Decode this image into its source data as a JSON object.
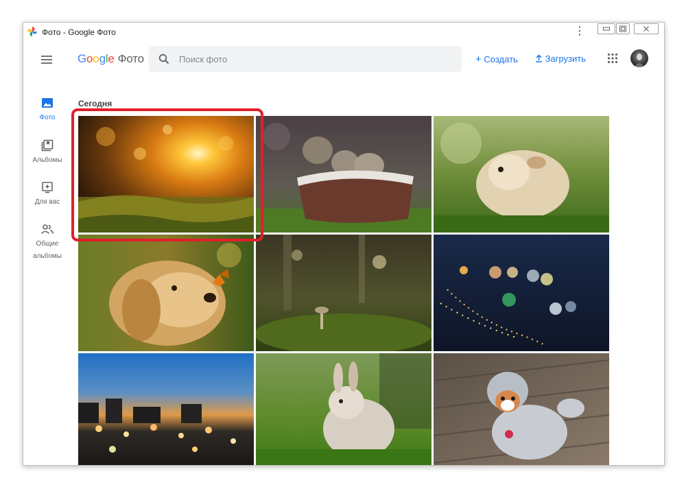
{
  "window": {
    "title": "Фото - Google Фото"
  },
  "header": {
    "logo": {
      "google": [
        "G",
        "o",
        "o",
        "g",
        "l",
        "e"
      ],
      "product": "Фото"
    },
    "search": {
      "placeholder": "Поиск фото"
    },
    "create_label": "Создать",
    "upload_label": "Загрузить",
    "icons": {
      "menu": "hamburger-menu-icon",
      "search": "search-icon",
      "apps": "apps-grid-icon",
      "create": "plus-icon",
      "upload": "upload-icon"
    }
  },
  "sidebar": {
    "items": [
      {
        "label": "Фото",
        "icon": "photo-icon",
        "active": true
      },
      {
        "label": "Альбомы",
        "icon": "albums-icon",
        "active": false
      },
      {
        "label": "Для вас",
        "icon": "for-you-icon",
        "active": false
      },
      {
        "label": "Общие\nальбомы",
        "icon": "shared-albums-icon",
        "active": false
      }
    ]
  },
  "main": {
    "section_title": "Сегодня",
    "photos": [
      {
        "subject": "sunset-bokeh"
      },
      {
        "subject": "kittens-in-basket"
      },
      {
        "subject": "guinea-pig"
      },
      {
        "subject": "dog-with-butterfly"
      },
      {
        "subject": "mushroom-forest"
      },
      {
        "subject": "string-lights-bokeh"
      },
      {
        "subject": "city-lights-dusk"
      },
      {
        "subject": "bunny-on-grass"
      },
      {
        "subject": "dog-in-costume"
      }
    ],
    "highlighted_photo_index": 0
  },
  "colors": {
    "accent": "#1a73e8",
    "highlight": "#e0202a"
  }
}
